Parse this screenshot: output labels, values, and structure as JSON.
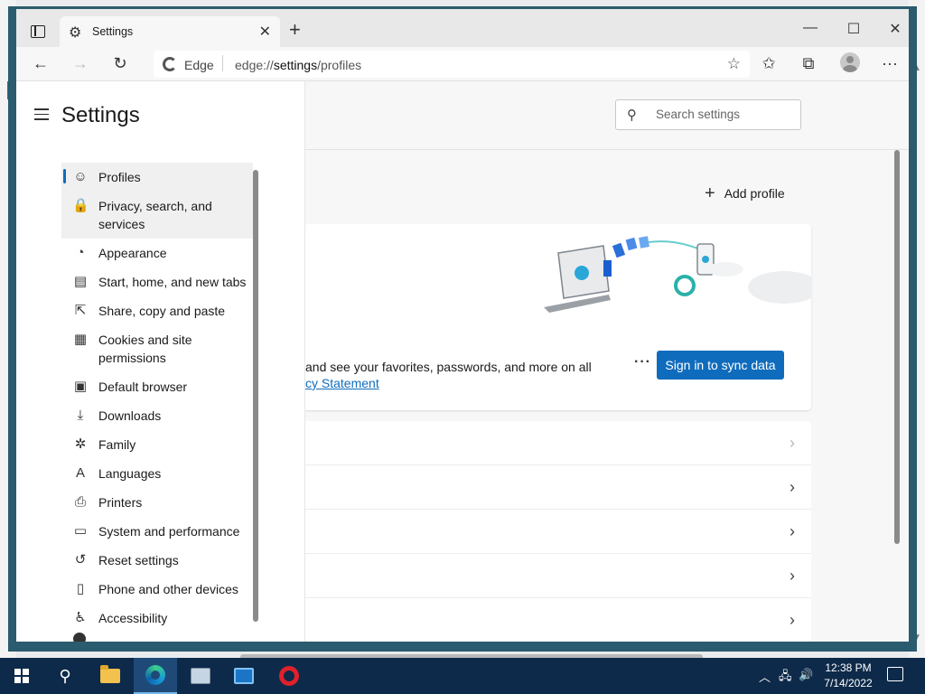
{
  "browser": {
    "tab_title": "Settings",
    "site_label": "Edge",
    "url_prefix": "edge://",
    "url_host": "settings",
    "url_path": "/profiles"
  },
  "window_controls": {
    "minimize": "—",
    "maximize": "☐",
    "close": "✕"
  },
  "header": {
    "search_placeholder": "Search settings"
  },
  "sidebar": {
    "title": "Settings",
    "items": [
      {
        "label": "Profiles",
        "icon": "profile-icon",
        "glyph": "☺"
      },
      {
        "label": "Privacy, search, and services",
        "icon": "lock-icon",
        "glyph": "🔒"
      },
      {
        "label": "Appearance",
        "icon": "palette-icon",
        "glyph": "◔"
      },
      {
        "label": "Start, home, and new tabs",
        "icon": "home-tabs-icon",
        "glyph": "▤"
      },
      {
        "label": "Share, copy and paste",
        "icon": "share-icon",
        "glyph": "⇱"
      },
      {
        "label": "Cookies and site permissions",
        "icon": "cookies-icon",
        "glyph": "▦"
      },
      {
        "label": "Default browser",
        "icon": "browser-icon",
        "glyph": "▣"
      },
      {
        "label": "Downloads",
        "icon": "download-icon",
        "glyph": "⤓"
      },
      {
        "label": "Family",
        "icon": "family-icon",
        "glyph": "✲"
      },
      {
        "label": "Languages",
        "icon": "languages-icon",
        "glyph": "A"
      },
      {
        "label": "Printers",
        "icon": "printer-icon",
        "glyph": "⎙"
      },
      {
        "label": "System and performance",
        "icon": "system-icon",
        "glyph": "▭"
      },
      {
        "label": "Reset settings",
        "icon": "reset-icon",
        "glyph": "↺"
      },
      {
        "label": "Phone and other devices",
        "icon": "phone-icon",
        "glyph": "▯"
      },
      {
        "label": "Accessibility",
        "icon": "accessibility-icon",
        "glyph": "♿"
      }
    ]
  },
  "profile": {
    "add_profile_label": "Add profile",
    "sync_text": "and see your favorites, passwords, and more on all",
    "privacy_link": "cy Statement",
    "more_label": "···",
    "sync_button": "Sign in to sync data"
  },
  "rows_count": 5,
  "taskbar": {
    "time": "12:38 PM",
    "date": "7/14/2022"
  },
  "colors": {
    "accent": "#0f6cbd",
    "taskbar": "#0e2a4a",
    "window_border": "#2b5b6e"
  }
}
